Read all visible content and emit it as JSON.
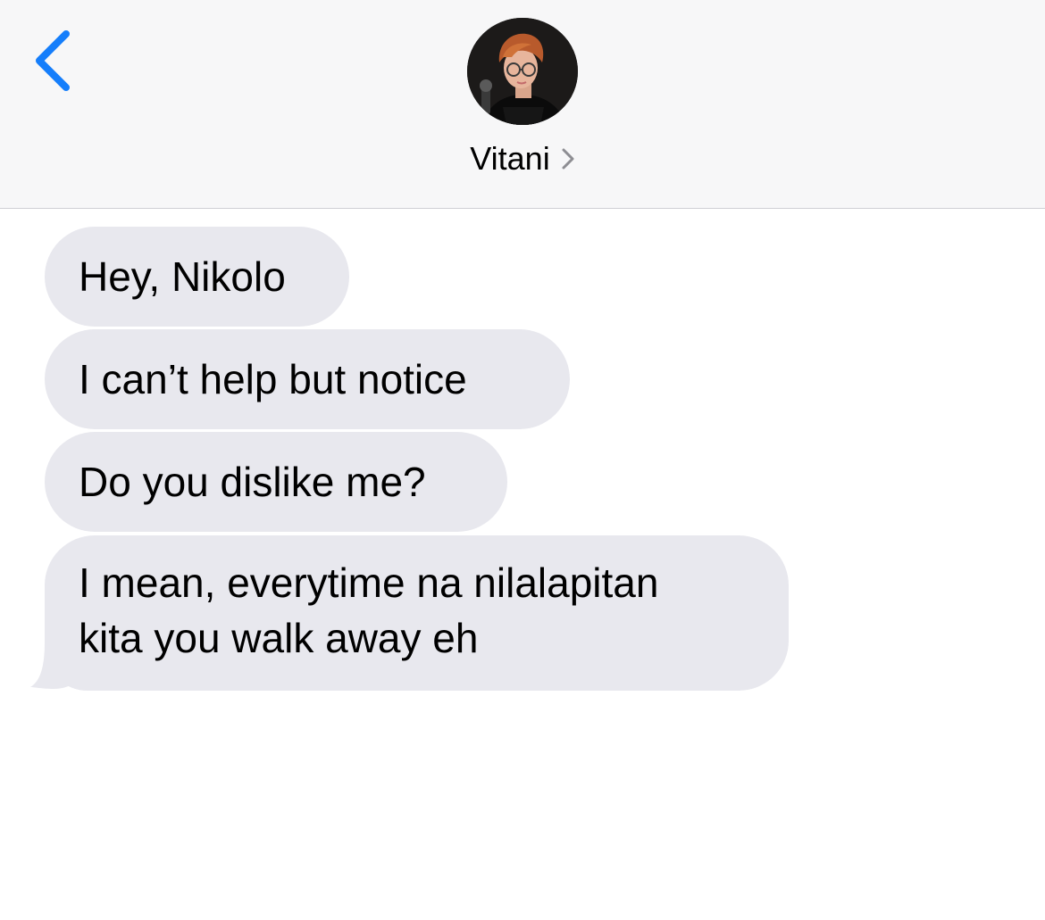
{
  "header": {
    "contact_name": "Vitani",
    "back_icon": "chevron-left-icon",
    "detail_icon": "chevron-right-icon",
    "accent_color": "#157efb"
  },
  "messages": [
    {
      "sender": "contact",
      "text": "Hey, Nikolo"
    },
    {
      "sender": "contact",
      "text": "I can’t help but notice"
    },
    {
      "sender": "contact",
      "text": "Do you dislike me?"
    },
    {
      "sender": "contact",
      "text": "I mean, everytime na nilalapitan\nkita you walk away eh"
    }
  ],
  "colors": {
    "header_bg": "#f7f7f8",
    "incoming_bubble": "#e8e8ee",
    "text": "#000000"
  }
}
